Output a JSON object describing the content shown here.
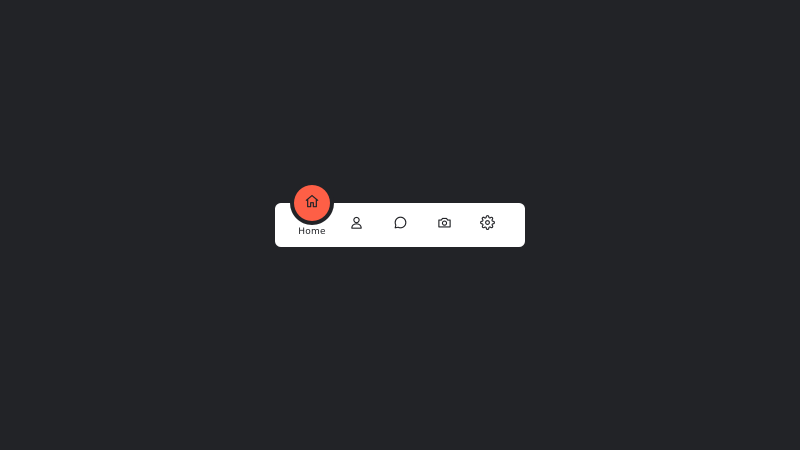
{
  "nav": {
    "active_index": 0,
    "items": [
      {
        "label": "Home",
        "icon": "home-icon"
      },
      {
        "label": "",
        "icon": "user-icon"
      },
      {
        "label": "",
        "icon": "message-icon"
      },
      {
        "label": "",
        "icon": "camera-icon"
      },
      {
        "label": "",
        "icon": "settings-icon"
      }
    ]
  },
  "colors": {
    "background": "#222327",
    "bar": "#ffffff",
    "accent": "#fe5f46",
    "icon": "#222327"
  }
}
